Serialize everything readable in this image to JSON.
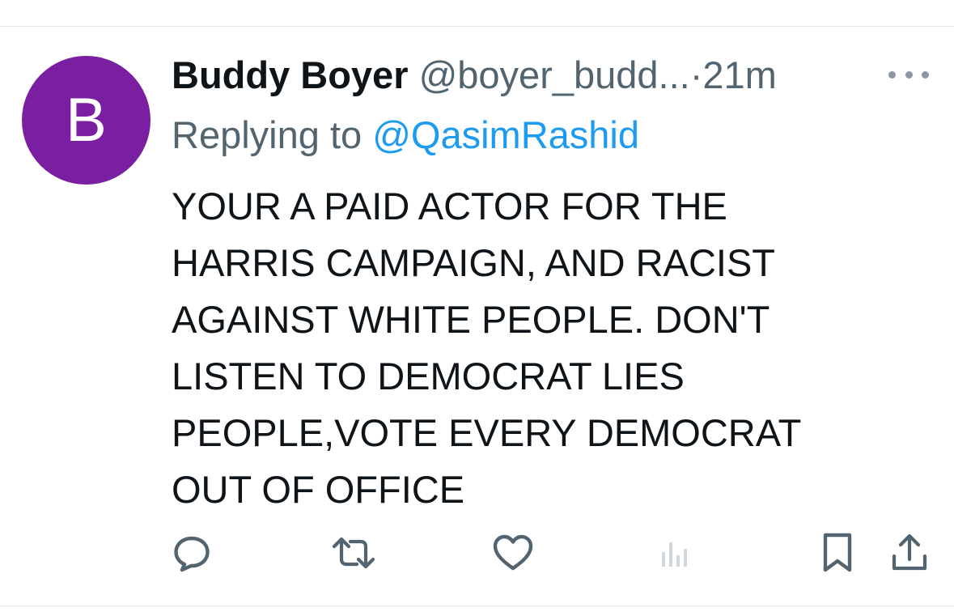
{
  "tweet": {
    "avatar_letter": "B",
    "avatar_color": "#7b1fa2",
    "display_name": "Buddy Boyer",
    "handle": "@boyer_budd...",
    "separator": "·",
    "time": "21m",
    "replying_prefix": "Replying to",
    "replying_to": "@QasimRashid",
    "text": "YOUR A PAID ACTOR FOR THE\nHARRIS CAMPAIGN, AND RACIST\nAGAINST WHITE PEOPLE. DON'T\nLISTEN TO DEMOCRAT LIES\nPEOPLE,VOTE EVERY DEMOCRAT\nOUT OF OFFICE"
  },
  "actions": {
    "icons": [
      "reply-icon",
      "retweet-icon",
      "like-icon",
      "views-icon",
      "bookmark-icon",
      "share-icon"
    ]
  },
  "colors": {
    "text": "#0f1419",
    "secondary": "#536471",
    "link": "#1d9bf0",
    "avatar": "#7b1fa2"
  }
}
